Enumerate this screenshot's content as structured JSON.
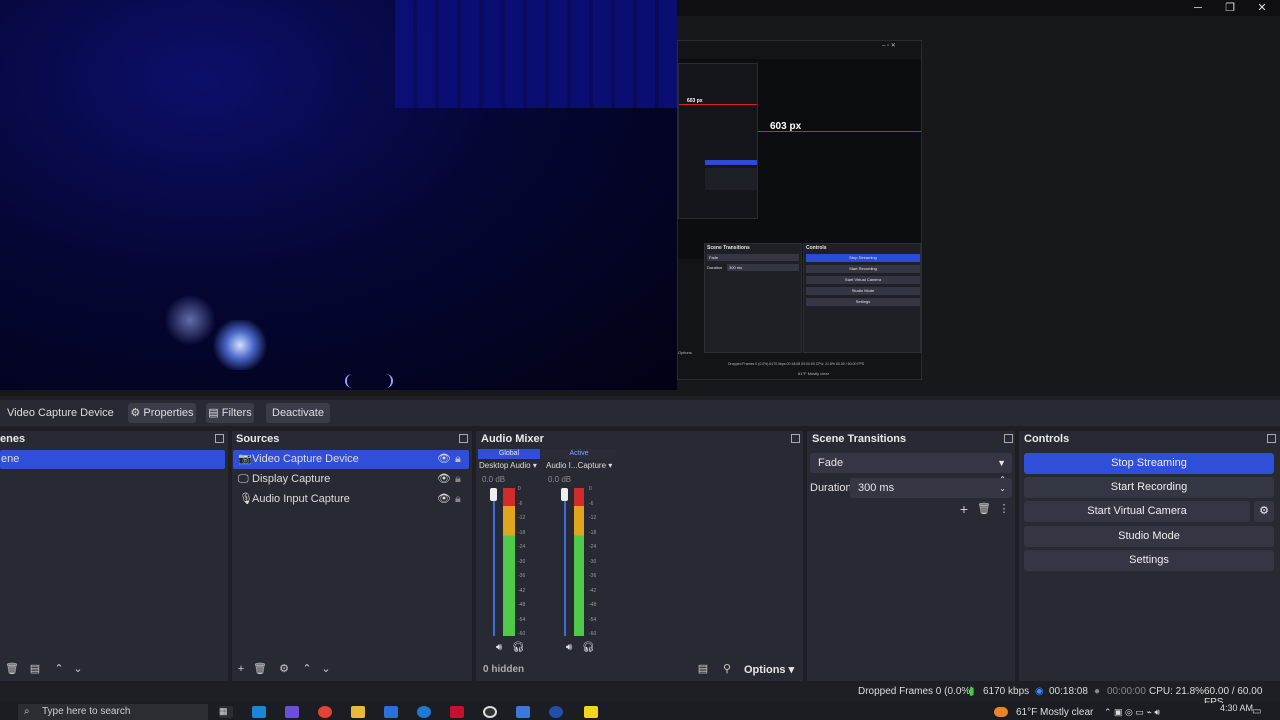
{
  "window": {
    "controls": {
      "minimize": "─",
      "maximize": "❐",
      "close": "✕"
    }
  },
  "preview": {
    "measure_label": "603 px",
    "small_measure_label": "603 px",
    "mini": {
      "scene_transitions": "Scene Transitions",
      "controls": "Controls",
      "fade": "Fade",
      "duration": "Duration",
      "duration_value": "300 ms",
      "stop_streaming": "Stop Streaming",
      "start_recording": "Start Recording",
      "start_virtual_camera": "Start Virtual Camera",
      "studio_mode": "Studio Mode",
      "settings": "Settings",
      "options": "Options",
      "status": "Dropped Frames 0 (0.0%)   6170 kbps   00:18:08   00:00:00   CPU: 21.8%   60.00 / 60.00 FPS",
      "weather": "61°F Mostly clear"
    }
  },
  "context_bar": {
    "source_label": "Video Capture Device",
    "properties": "Properties",
    "filters": "Filters",
    "deactivate": "Deactivate"
  },
  "scenes": {
    "title": "enes",
    "items": [
      {
        "label": "ene"
      }
    ]
  },
  "sources": {
    "title": "Sources",
    "items": [
      {
        "label": "Video Capture Device",
        "icon": "camera-icon"
      },
      {
        "label": "Display Capture",
        "icon": "monitor-icon"
      },
      {
        "label": "Audio Input Capture",
        "icon": "microphone-icon"
      }
    ]
  },
  "audio_mixer": {
    "title": "Audio Mixer",
    "tab_global": "Global",
    "tab_active": "Active",
    "channels": [
      {
        "name": "Desktop Audio",
        "db": "0.0 dB"
      },
      {
        "name": "Audio I...Capture",
        "db": "0.0 dB"
      }
    ],
    "ticks": [
      "0",
      "-6",
      "-12",
      "-18",
      "-24",
      "-30",
      "-36",
      "-42",
      "-48",
      "-54",
      "-60"
    ],
    "hidden": "0 hidden",
    "options": "Options"
  },
  "scene_transitions": {
    "title": "Scene Transitions",
    "transition": "Fade",
    "duration_label": "Duration",
    "duration_value": "300 ms"
  },
  "controls": {
    "title": "Controls",
    "stop_streaming": "Stop Streaming",
    "start_recording": "Start Recording",
    "start_virtual_camera": "Start Virtual Camera",
    "studio_mode": "Studio Mode",
    "settings": "Settings"
  },
  "status_bar": {
    "dropped_frames": "Dropped Frames 0 (0.0%)",
    "bitrate": "6170 kbps",
    "stream_time": "00:18:08",
    "record_time": "00:00:00",
    "cpu": "CPU: 21.8%",
    "fps": "60.00 / 60.00 FPS"
  },
  "taskbar": {
    "search_placeholder": "Type here to search",
    "weather": "61°F  Mostly clear",
    "time": "4:30 AM"
  },
  "colors": {
    "accent": "#2f4fd8",
    "panel": "#272a33",
    "background": "#1e1f24",
    "meter_green": "#50c84a",
    "meter_yellow": "#e0a51b",
    "meter_red": "#d12b2b"
  }
}
